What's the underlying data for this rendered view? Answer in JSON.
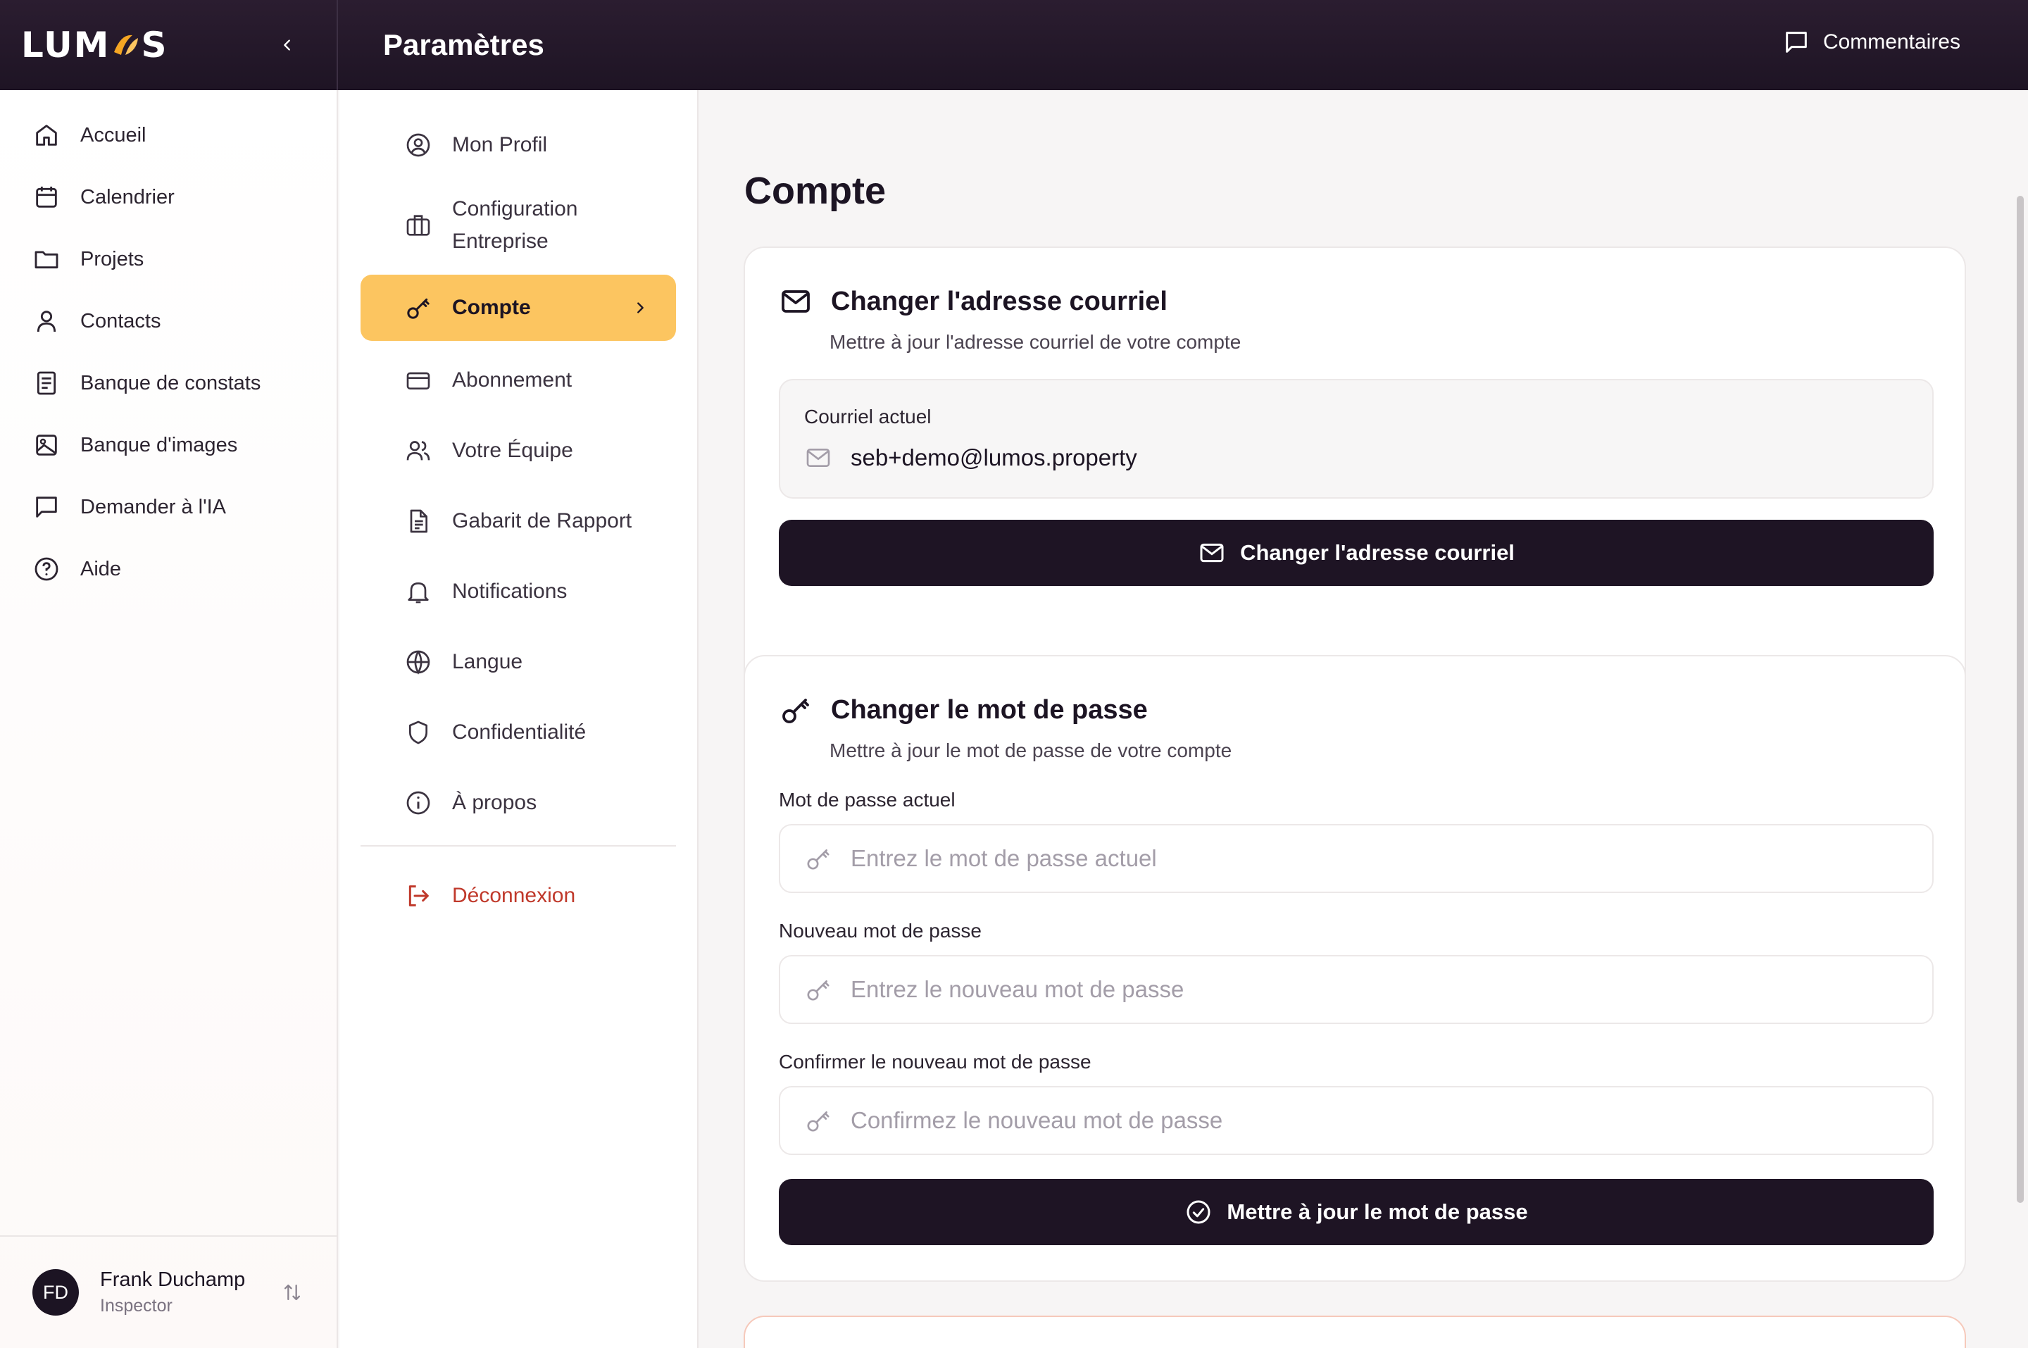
{
  "app": {
    "logo_text_left": "LUM",
    "logo_text_right": "S",
    "page_title": "Paramètres",
    "comments_label": "Commentaires"
  },
  "sidebar": {
    "items": [
      {
        "label": "Accueil",
        "icon": "home-icon"
      },
      {
        "label": "Calendrier",
        "icon": "calendar-icon"
      },
      {
        "label": "Projets",
        "icon": "folder-icon"
      },
      {
        "label": "Contacts",
        "icon": "user-icon"
      },
      {
        "label": "Banque de constats",
        "icon": "document-icon"
      },
      {
        "label": "Banque d'images",
        "icon": "image-icon"
      },
      {
        "label": "Demander à l'IA",
        "icon": "chat-icon"
      },
      {
        "label": "Aide",
        "icon": "help-icon"
      }
    ],
    "user": {
      "initials": "FD",
      "name": "Frank Duchamp",
      "role": "Inspector"
    }
  },
  "settings_nav": {
    "items": [
      {
        "label": "Mon Profil",
        "icon": "profile-icon"
      },
      {
        "label_line1": "Configuration",
        "label_line2": "Entreprise",
        "icon": "briefcase-icon"
      },
      {
        "label": "Compte",
        "icon": "key-icon",
        "active": true
      },
      {
        "label": "Abonnement",
        "icon": "credit-card-icon"
      },
      {
        "label": "Votre Équipe",
        "icon": "team-icon"
      },
      {
        "label": "Gabarit de Rapport",
        "icon": "file-text-icon"
      },
      {
        "label": "Notifications",
        "icon": "bell-icon"
      },
      {
        "label": "Langue",
        "icon": "globe-icon"
      },
      {
        "label": "Confidentialité",
        "icon": "shield-icon"
      },
      {
        "label": "À propos",
        "icon": "info-icon"
      }
    ],
    "logout_label": "Déconnexion"
  },
  "main": {
    "title": "Compte",
    "email_card": {
      "title": "Changer l'adresse courriel",
      "subtitle": "Mettre à jour l'adresse courriel de votre compte",
      "current_label": "Courriel actuel",
      "current_value": "seb+demo@lumos.property",
      "button_label": "Changer l'adresse courriel"
    },
    "password_card": {
      "title": "Changer le mot de passe",
      "subtitle": "Mettre à jour le mot de passe de votre compte",
      "current_label": "Mot de passe actuel",
      "current_placeholder": "Entrez le mot de passe actuel",
      "new_label": "Nouveau mot de passe",
      "new_placeholder": "Entrez le nouveau mot de passe",
      "confirm_label": "Confirmer le nouveau mot de passe",
      "confirm_placeholder": "Confirmez le nouveau mot de passe",
      "button_label": "Mettre à jour le mot de passe"
    }
  },
  "colors": {
    "topbar": "#1e1424",
    "accent": "#fcc560",
    "primary_button": "#1e1424",
    "danger": "#c0392b"
  }
}
